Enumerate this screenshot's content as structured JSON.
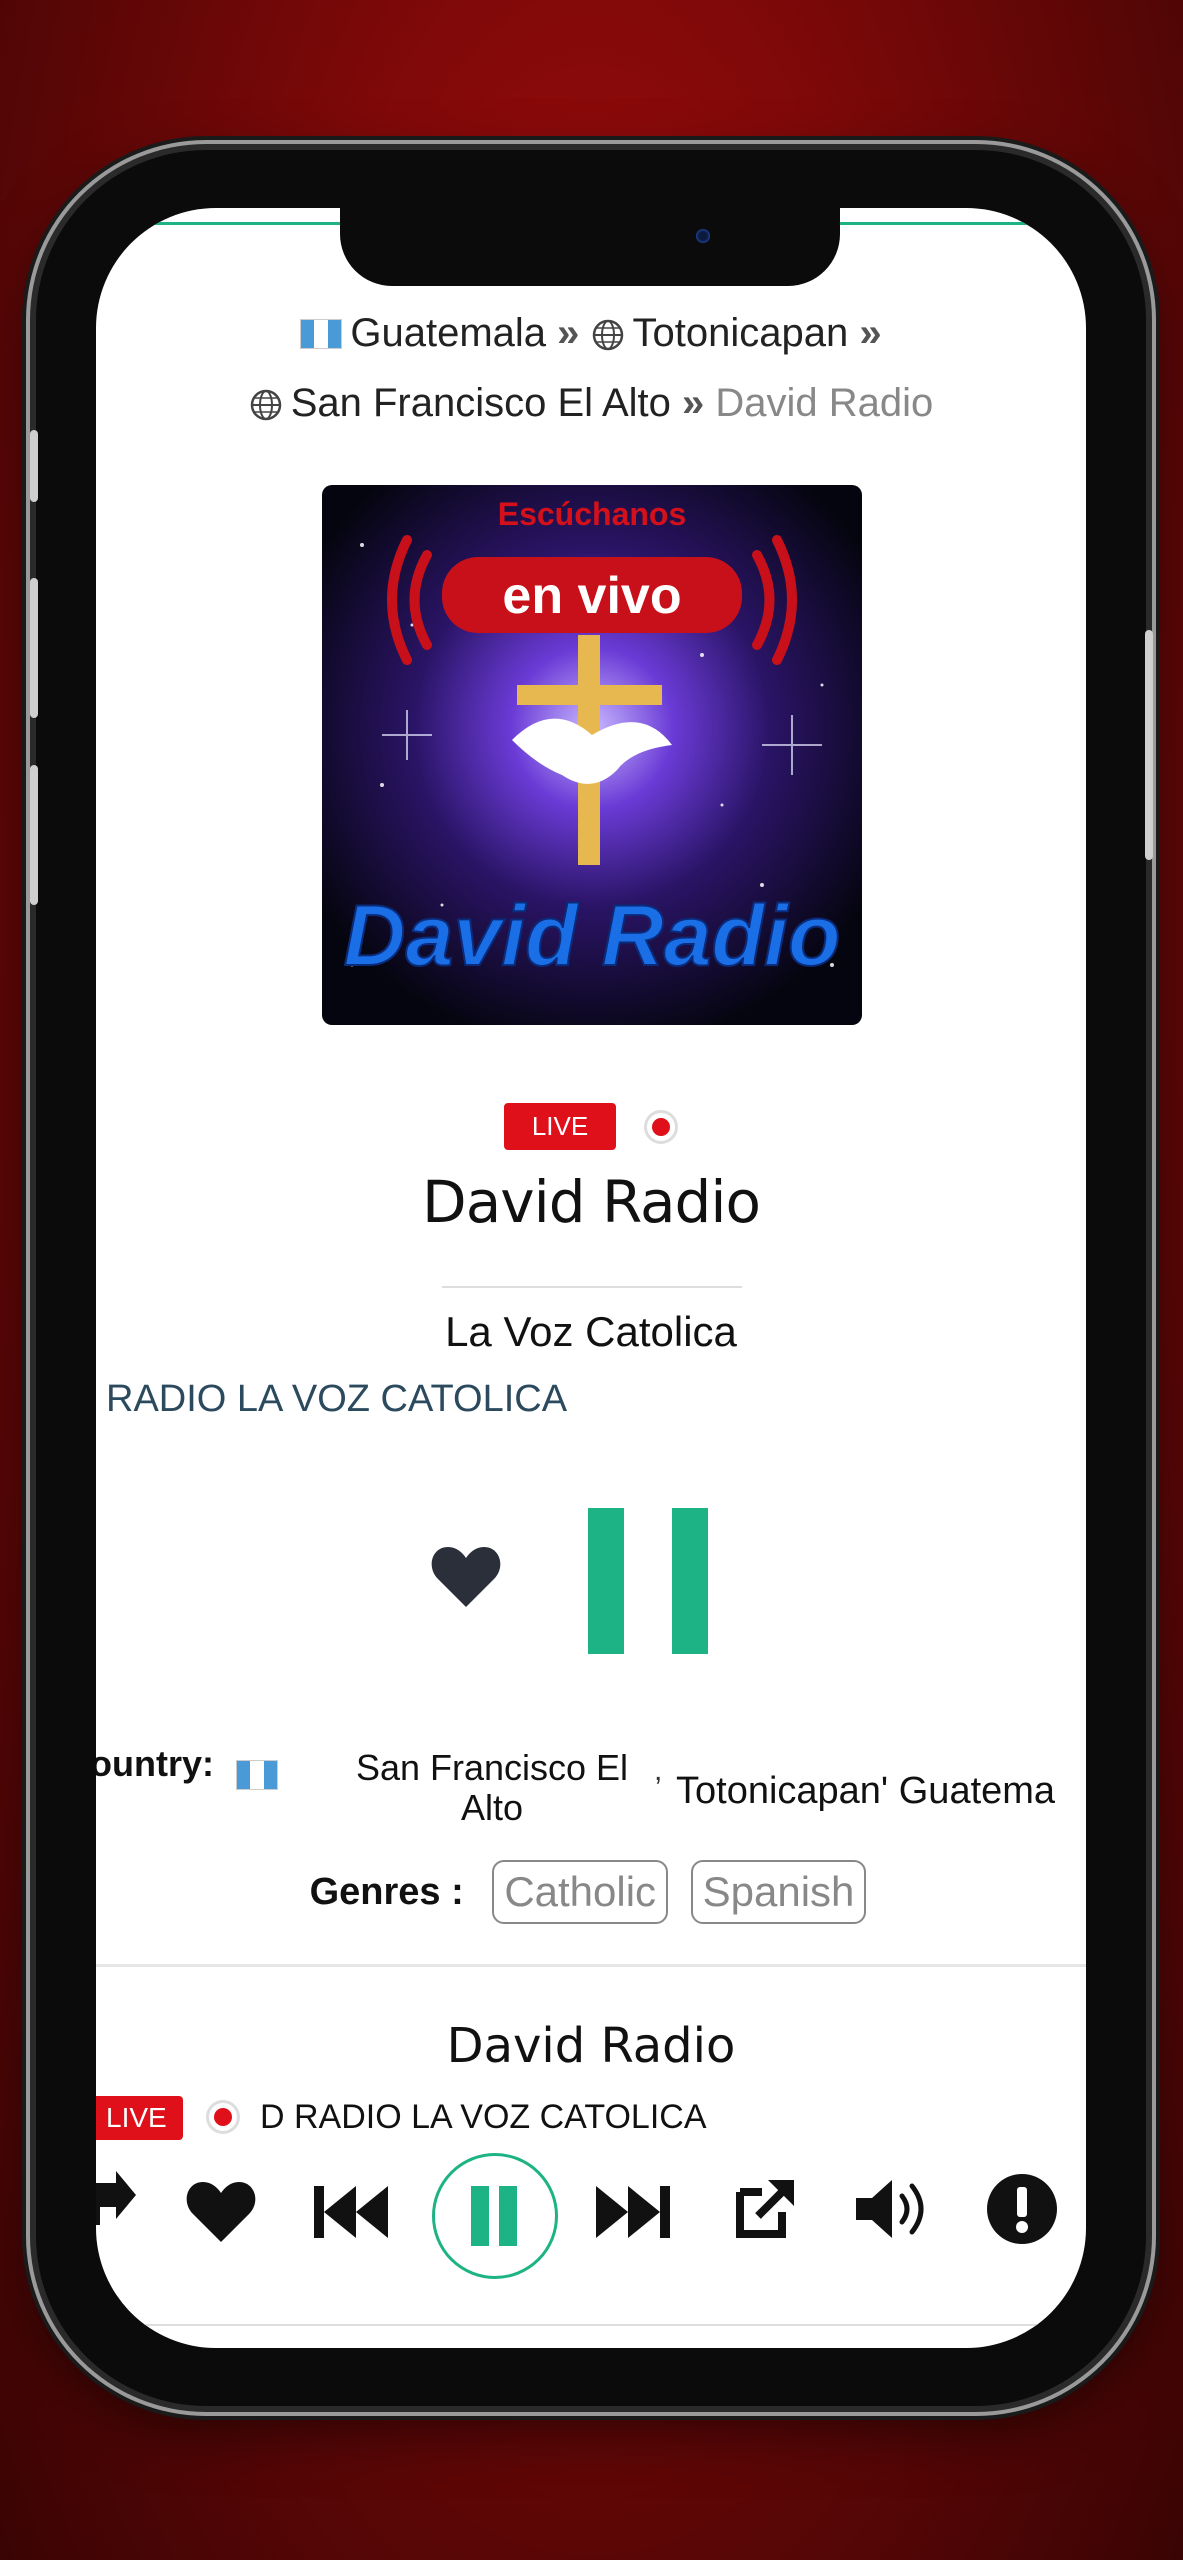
{
  "breadcrumb": {
    "country": "Guatemala",
    "region": "Totonicapan",
    "city": "San Francisco El Alto",
    "current": "David Radio",
    "separator": "»"
  },
  "station": {
    "live_label": "LIVE",
    "name": "David Radio",
    "slogan": "La Voz Catolica",
    "now_playing": "RADIO LA VOZ CATOLICA"
  },
  "cover": {
    "top_text": "Escúchanos",
    "middle_text": "en vivo",
    "bottom_text": "David Radio"
  },
  "details": {
    "country_label": "ountry:",
    "city_line1": "San Francisco El",
    "city_line2": "Alto",
    "comma": ",",
    "region_country": "Totonicapan' Guatema",
    "genres_label": "Genres :",
    "genres": [
      "Catholic",
      "Spanish"
    ]
  },
  "mini_player": {
    "title": "David Radio",
    "live_label": "LIVE",
    "now_playing": "D RADIO LA VOZ CATOLICA"
  },
  "colors": {
    "accent": "#1db384",
    "live": "#e0101a",
    "background": "#8e0a0a"
  },
  "icons": [
    "share-icon",
    "heart-icon",
    "previous-icon",
    "pause-icon",
    "next-icon",
    "external-link-icon",
    "volume-icon",
    "alert-icon"
  ]
}
